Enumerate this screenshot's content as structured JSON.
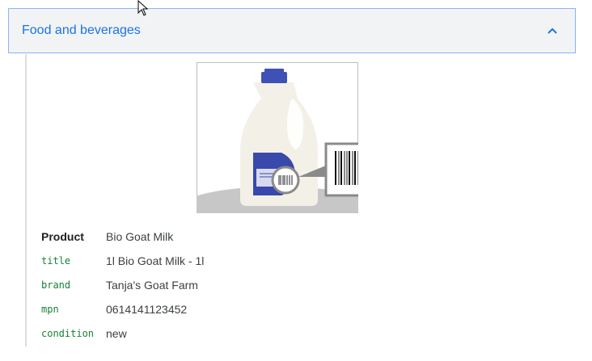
{
  "accordion": {
    "title": "Food and beverages",
    "expanded": true,
    "chevron_icon": "chevron-up-icon",
    "accent_color": "#1a73e8"
  },
  "illustration": {
    "icon": "milk-jug-barcode-illustration"
  },
  "attributes": [
    {
      "key": "Product",
      "value": "Bio Goat Milk"
    },
    {
      "key": "title",
      "value": "1l Bio Goat Milk - 1l"
    },
    {
      "key": "brand",
      "value": "Tanja's Goat Farm"
    },
    {
      "key": "mpn",
      "value": "0614141123452"
    },
    {
      "key": "condition",
      "value": "new"
    }
  ]
}
